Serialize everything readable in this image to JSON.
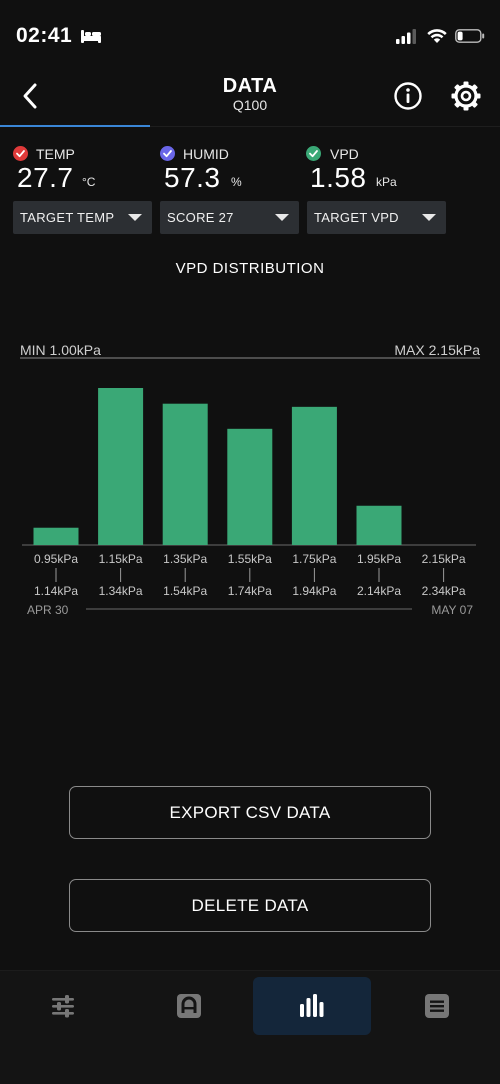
{
  "status_bar": {
    "time": "02:41"
  },
  "header": {
    "title": "DATA",
    "subtitle": "Q100"
  },
  "sensors": [
    {
      "label": "TEMP",
      "value": "27.7",
      "unit": "°C",
      "dot_color": "#e03a3a"
    },
    {
      "label": "HUMID",
      "value": "57.3",
      "unit": "%",
      "dot_color": "#6a66e8"
    },
    {
      "label": "VPD",
      "value": "1.58",
      "unit": "kPa",
      "dot_color": "#3aa876"
    }
  ],
  "dropdowns": [
    {
      "label": "TARGET TEMP"
    },
    {
      "label": "SCORE 27"
    },
    {
      "label": "TARGET VPD"
    }
  ],
  "chart_title": "VPD DISTRIBUTION",
  "chart_data": {
    "type": "bar",
    "min_label": "MIN 1.00kPa",
    "max_label": "MAX 2.15kPa",
    "categories": [
      {
        "from": "0.95kPa",
        "to": "1.14kPa"
      },
      {
        "from": "1.15kPa",
        "to": "1.34kPa"
      },
      {
        "from": "1.35kPa",
        "to": "1.54kPa"
      },
      {
        "from": "1.55kPa",
        "to": "1.74kPa"
      },
      {
        "from": "1.75kPa",
        "to": "1.94kPa"
      },
      {
        "from": "1.95kPa",
        "to": "2.14kPa"
      },
      {
        "from": "2.15kPa",
        "to": "2.34kPa"
      }
    ],
    "values": [
      11,
      100,
      90,
      74,
      88,
      25,
      0
    ],
    "date_start": "APR 30",
    "date_end": "MAY 07",
    "bar_color": "#3aa876"
  },
  "buttons": {
    "export": "EXPORT CSV DATA",
    "delete": "DELETE DATA"
  },
  "colors": {
    "accent": "#3a86d6",
    "bar": "#3aa876",
    "background": "#101010"
  }
}
